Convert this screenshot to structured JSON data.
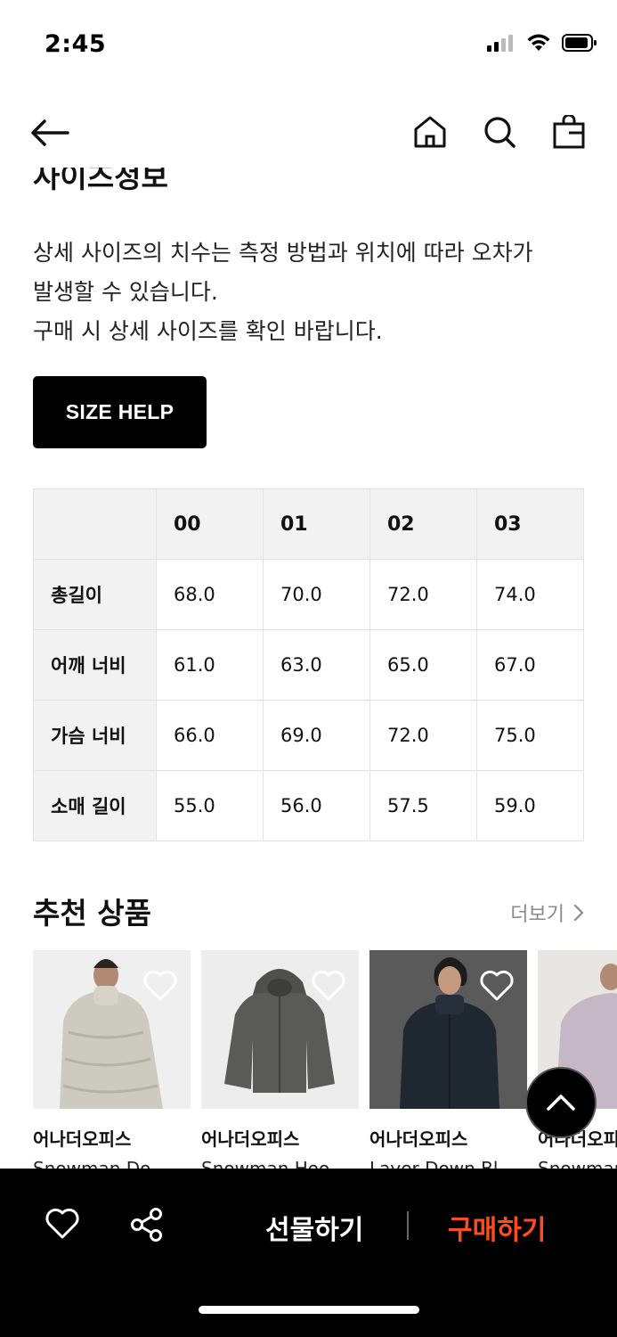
{
  "status_bar": {
    "time": "2:45"
  },
  "size_info": {
    "title": "사이즈정보",
    "description": [
      "상세 사이즈의 치수는 측정 방법과 위치에 따라 오차가",
      "발생할 수 있습니다.",
      "구매 시 상세 사이즈를 확인 바랍니다."
    ],
    "size_help_label": "SIZE HELP",
    "table": {
      "columns": [
        "00",
        "01",
        "02",
        "03"
      ],
      "rows": [
        {
          "label": "총길이",
          "values": [
            "68.0",
            "70.0",
            "72.0",
            "74.0"
          ]
        },
        {
          "label": "어깨 너비",
          "values": [
            "61.0",
            "63.0",
            "65.0",
            "67.0"
          ]
        },
        {
          "label": "가슴 너비",
          "values": [
            "66.0",
            "69.0",
            "72.0",
            "75.0"
          ]
        },
        {
          "label": "소매 길이",
          "values": [
            "55.0",
            "56.0",
            "57.5",
            "59.0"
          ]
        }
      ]
    }
  },
  "recommended": {
    "title": "추천 상품",
    "more_label": "더보기",
    "products": [
      {
        "brand": "어나더오피스",
        "name": "Snowman Do"
      },
      {
        "brand": "어나더오피스",
        "name": "Snowman Hoo"
      },
      {
        "brand": "어나더오피스",
        "name": "Layer Down Bl"
      },
      {
        "brand": "어나더오피스",
        "name": "Snowman"
      }
    ]
  },
  "bottom_bar": {
    "gift_label": "선물하기",
    "buy_label": "구매하기"
  },
  "colors": {
    "accent": "#ff4b1f",
    "header_cell_bg": "#f2f2f2",
    "bottom_bar_bg": "#000000"
  },
  "icons": [
    "back-arrow-icon",
    "home-icon",
    "search-icon",
    "shopping-bag-icon",
    "heart-icon",
    "share-icon",
    "chevron-right-icon",
    "chevron-up-icon"
  ]
}
